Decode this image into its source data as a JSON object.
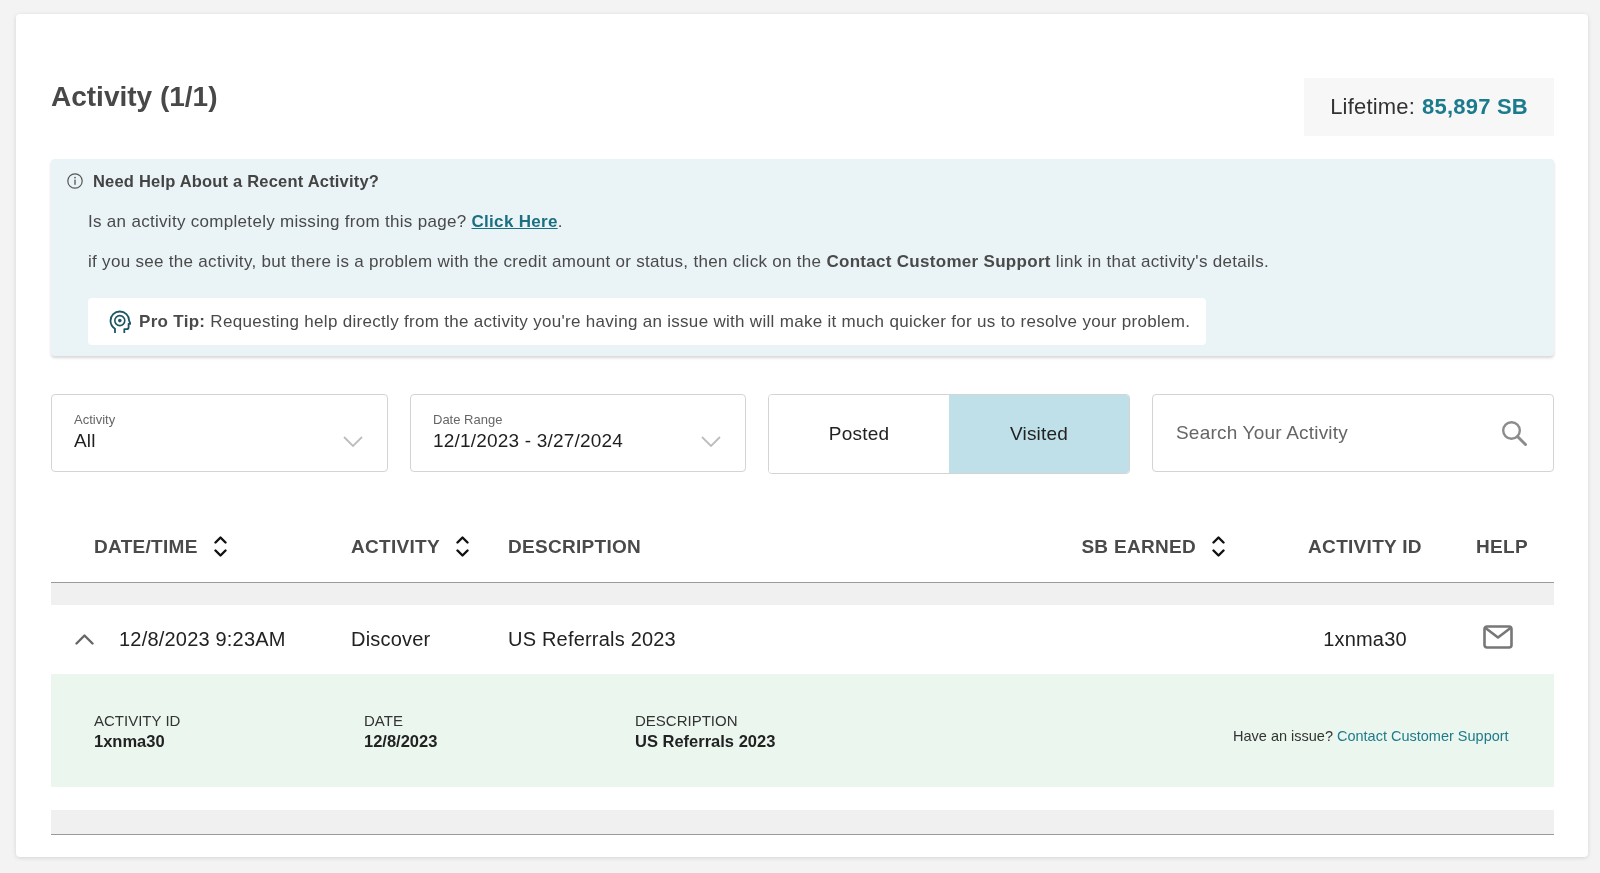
{
  "header": {
    "title": "Activity (1/1)",
    "lifetime": {
      "label": "Lifetime:",
      "value": "85,897 SB"
    }
  },
  "help_panel": {
    "title": "Need Help About a Recent Activity?",
    "missing_prompt": {
      "text": "Is an activity completely missing from this page?",
      "link": "Click Here",
      "after": "."
    },
    "problem_note": "if you see the activity, but there is a problem with the credit amount or status, then click on the **Contact Customer Support** link in that activity's details.",
    "pro_tip": "**Pro Tip:** Requesting help directly from the activity you're having an issue with will make it much quicker for us to resolve your problem."
  },
  "filters": [
    {
      "kind": "dropdown",
      "label": "Activity",
      "value": "All"
    },
    {
      "kind": "dropdown",
      "label": "Date Range",
      "value": "12/1/2023 - 3/27/2024"
    }
  ],
  "view_toggle": [
    {
      "label": "Posted",
      "selected": false
    },
    {
      "label": "Visited",
      "selected": true
    }
  ],
  "search": {
    "placeholder": "Search Your Activity"
  },
  "table": {
    "columns": [
      {
        "label": "DATE/TIME",
        "sortable": true
      },
      {
        "label": "ACTIVITY",
        "sortable": true
      },
      {
        "label": "DESCRIPTION",
        "sortable": false
      },
      {
        "label": "SB EARNED",
        "sortable": true
      },
      {
        "label": "ACTIVITY ID",
        "sortable": false
      },
      {
        "label": "HELP",
        "sortable": false
      }
    ],
    "rows": [
      {
        "expanded": true,
        "date_time": "12/8/2023 9:23AM",
        "activity": "Discover",
        "description": "US Referrals 2023",
        "activity_id": "1xnma30",
        "details": {
          "fields": [
            {
              "label": "ACTIVITY ID",
              "value": "1xnma30"
            },
            {
              "label": "DATE",
              "value": "12/8/2023"
            },
            {
              "label": "DESCRIPTION",
              "value": "US Referrals 2023"
            }
          ],
          "issue": {
            "text": "Have an issue?",
            "link": "Contact Customer Support"
          }
        }
      }
    ]
  }
}
